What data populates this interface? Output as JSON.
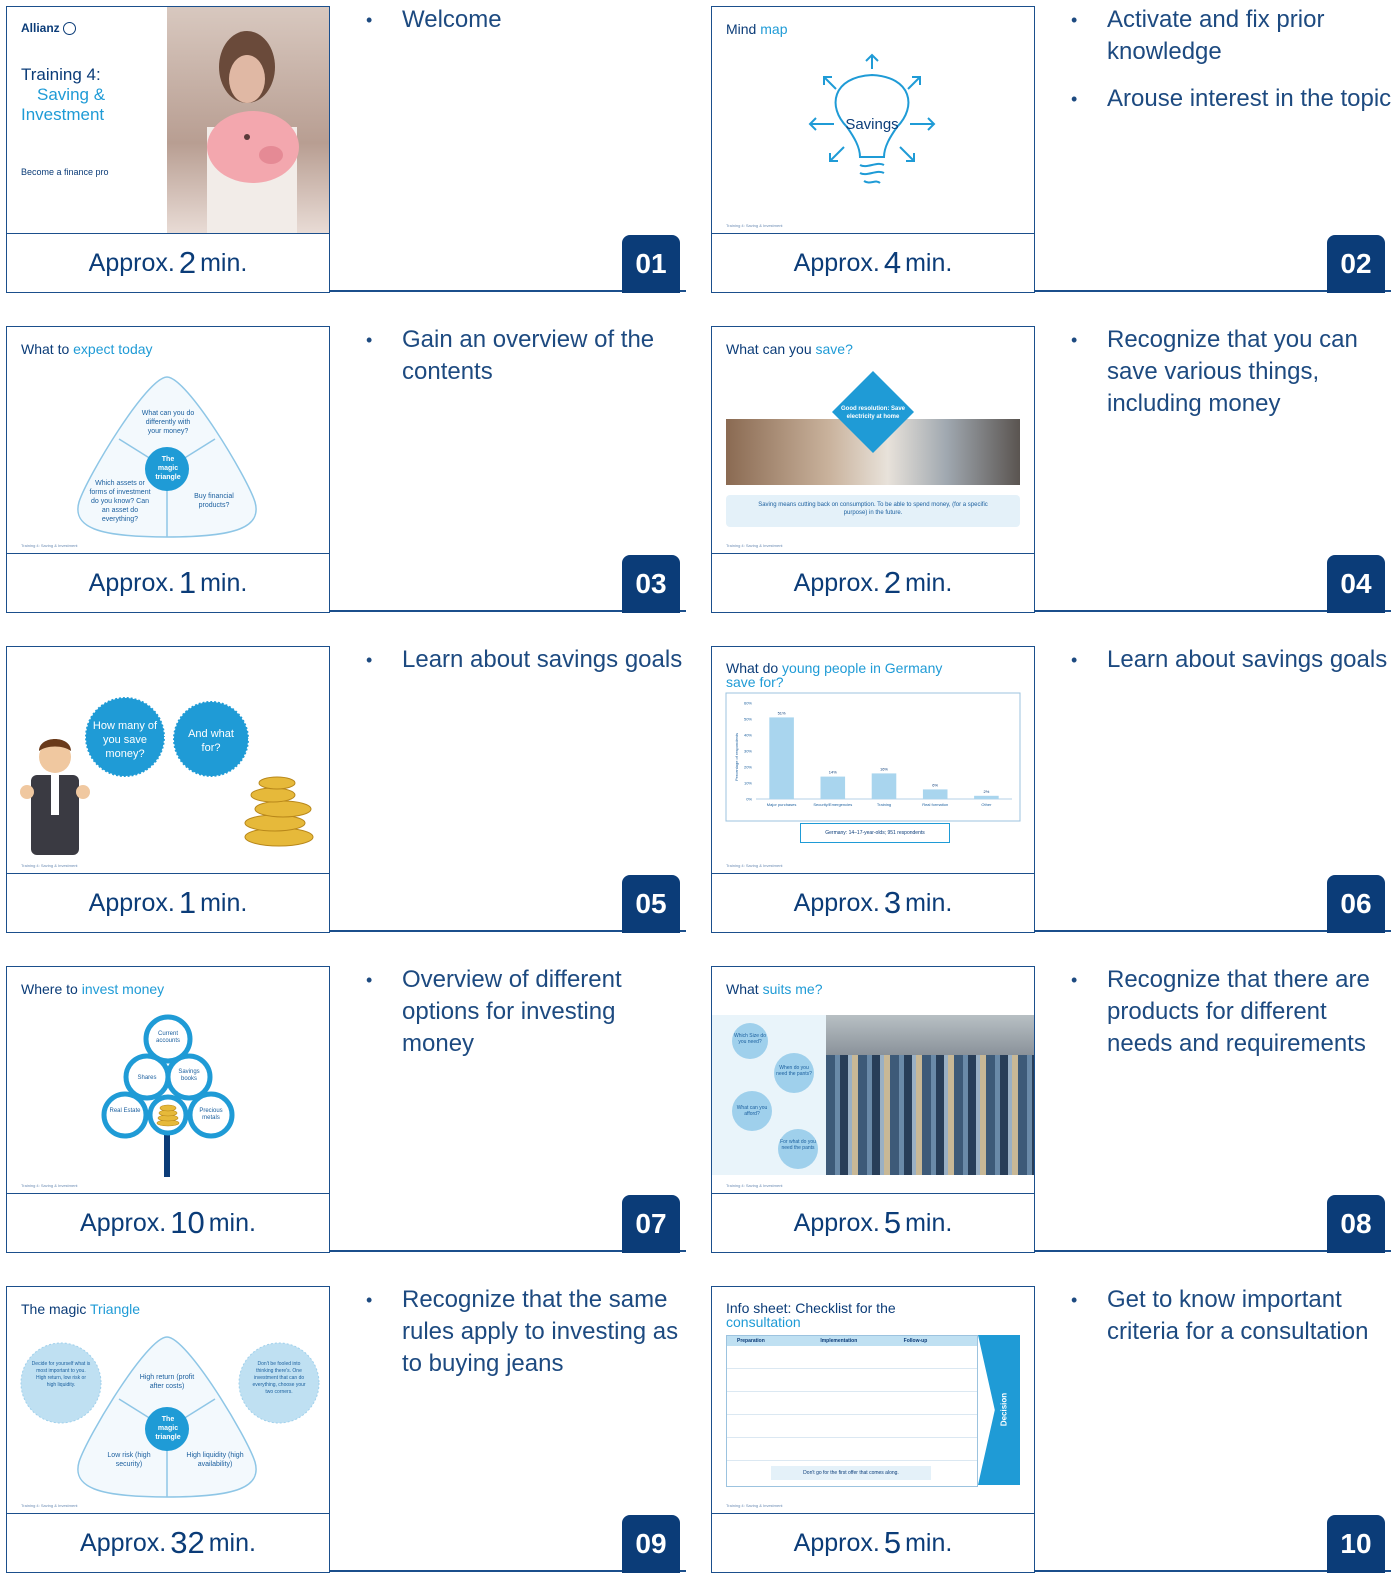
{
  "slides": [
    {
      "num": "01",
      "prefix": "Approx.",
      "minutes": "2",
      "unit": "min.",
      "bullets": [
        "Welcome"
      ]
    },
    {
      "num": "02",
      "prefix": "Approx.",
      "minutes": "4",
      "unit": "min.",
      "bullets": [
        "Activate and fix prior knowledge",
        "Arouse interest in the topic"
      ]
    },
    {
      "num": "03",
      "prefix": "Approx.",
      "minutes": "1",
      "unit": "min.",
      "bullets": [
        "Gain an overview of the contents"
      ]
    },
    {
      "num": "04",
      "prefix": "Approx.",
      "minutes": "2",
      "unit": "min.",
      "bullets": [
        "Recognize that you can save various things, including money"
      ]
    },
    {
      "num": "05",
      "prefix": "Approx.",
      "minutes": "1",
      "unit": "min.",
      "bullets": [
        "Learn about savings goals"
      ]
    },
    {
      "num": "06",
      "prefix": "Approx.",
      "minutes": "3",
      "unit": "min.",
      "bullets": [
        "Learn about savings goals"
      ]
    },
    {
      "num": "07",
      "prefix": "Approx.",
      "minutes": "10",
      "unit": "min.",
      "bullets": [
        "Overview of different options for investing money"
      ]
    },
    {
      "num": "08",
      "prefix": "Approx.",
      "minutes": "5",
      "unit": "min.",
      "bullets": [
        "Recognize that there are products for different needs and requirements"
      ]
    },
    {
      "num": "09",
      "prefix": "Approx.",
      "minutes": "32",
      "unit": "min.",
      "bullets": [
        "Recognize that the same rules apply to investing as to buying jeans"
      ]
    },
    {
      "num": "10",
      "prefix": "Approx.",
      "minutes": "5",
      "unit": "min.",
      "bullets": [
        "Get to know important criteria for a consultation"
      ]
    }
  ],
  "thumbs": {
    "s1": {
      "brand": "Allianz",
      "title1": "Training 4:",
      "title2": "Saving &",
      "title3": "Investment",
      "tagline": "Become a finance pro"
    },
    "s2": {
      "title": "Mind",
      "title_hl": "map",
      "center": "Savings"
    },
    "s3": {
      "title": "What to",
      "title_hl": "expect today",
      "top": "What can you do differently with your money?",
      "center": "The magic triangle",
      "left": "Which assets or forms of investment do you know? Can an asset do everything?",
      "right": "Buy financial products?"
    },
    "s4": {
      "title": "What can you",
      "title_hl": "save?",
      "diamond": "Good resolution: Save electricity at home",
      "caption": "Saving means cutting back on consumption. To be able to spend money, (for a specific purpose) in the future."
    },
    "s5": {
      "bubble1": "How many of you save money?",
      "bubble1_hl": "save",
      "bubble2": "And what for?"
    },
    "s6": {
      "title": "What do",
      "title_hl": "young people in Germany",
      "title_end": "save for?",
      "note": "Germany: 14–17-year-olds; 951 respondents"
    },
    "s7": {
      "title": "Where to",
      "title_hl": "invest money",
      "n1": "Current accounts",
      "n2": "Shares",
      "n3": "Savings books",
      "n4": "Real Estate",
      "n5": "Precious metals"
    },
    "s8": {
      "title": "What",
      "title_hl": "suits me?",
      "c1": "Which Size do you need?",
      "c2": "When do you need the pants?",
      "c3": "What can you afford?",
      "c4": "For what do you need the pants"
    },
    "s9": {
      "title": "The magic",
      "title_hl": "Triangle",
      "top": "High return (profit after costs)",
      "center": "The magic triangle",
      "left": "Low risk (high security)",
      "right": "High liquidity (high availability)",
      "bubbleL": "Decide for yourself what is most important to you. High return, low risk or high liquidity.",
      "bubbleR": "Don't be fooled into thinking there's. One investment that can do everything, choose your two corners."
    },
    "s10": {
      "title": "Info sheet: Checklist for the",
      "title_hl": "consultation",
      "h1": "Preparation",
      "h2": "Implementation",
      "h3": "Follow-up",
      "side": "Decision",
      "bottom": "Don't go for the first offer that comes along."
    }
  },
  "chart_data": {
    "type": "bar",
    "categories": [
      "Major purchases",
      "Security/Emergencies",
      "Training",
      "Real formation",
      "Other"
    ],
    "values": [
      51,
      14,
      16,
      6,
      2
    ],
    "value_labels": [
      "51%",
      "14%",
      "16%",
      "6%",
      "2%"
    ],
    "ylabel": "Percentage of respondents",
    "ylim": [
      0,
      60
    ],
    "yticks": [
      "0%",
      "10%",
      "20%",
      "30%",
      "40%",
      "50%",
      "60%"
    ]
  },
  "footer_text": "Training 4: Saving & Investment",
  "colors": {
    "navy": "#0b3c78",
    "accent": "#1f9bd6",
    "light": "#cfe6f4"
  }
}
